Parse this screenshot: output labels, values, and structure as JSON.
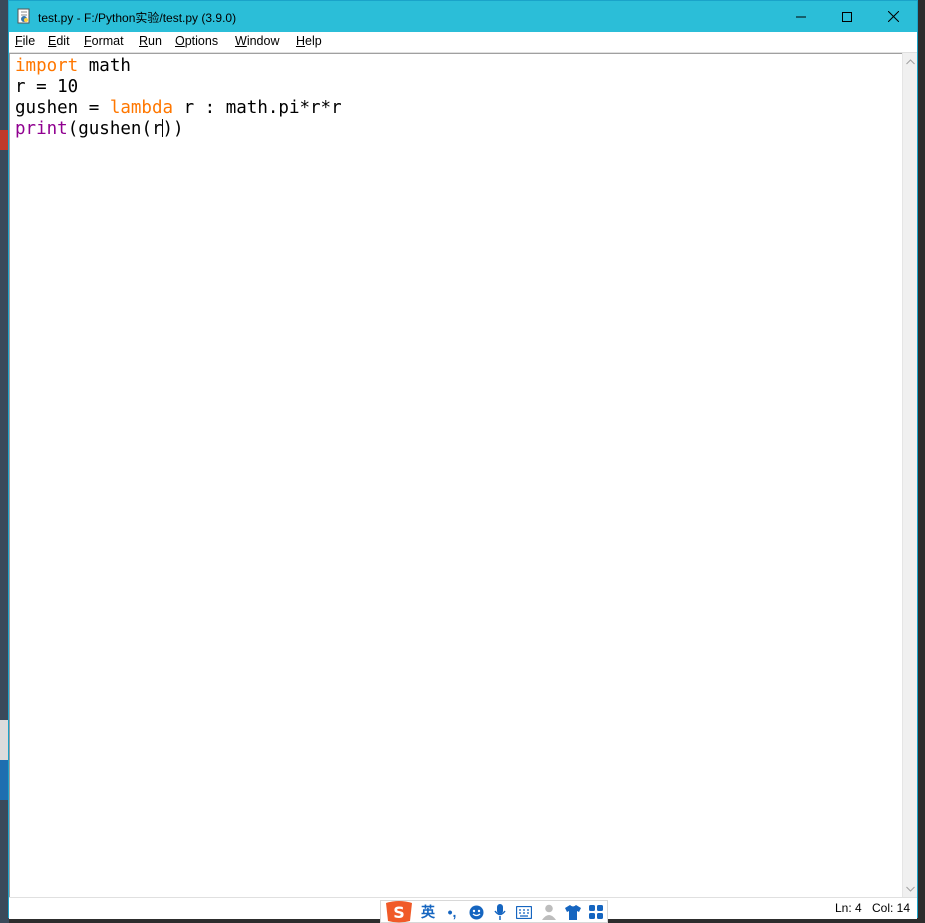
{
  "window": {
    "title": "test.py - F:/Python实验/test.py (3.9.0)",
    "controls": {
      "minimize": "minimize",
      "maximize": "maximize",
      "close": "close"
    }
  },
  "menubar": {
    "items": [
      {
        "label": "File",
        "mnemonic": "F",
        "rest": "ile"
      },
      {
        "label": "Edit",
        "mnemonic": "E",
        "rest": "dit"
      },
      {
        "label": "Format",
        "mnemonic": "F",
        "rest": "ormat"
      },
      {
        "label": "Run",
        "mnemonic": "R",
        "rest": "un"
      },
      {
        "label": "Options",
        "mnemonic": "O",
        "rest": "ptions"
      },
      {
        "label": "Window",
        "mnemonic": "W",
        "rest": "indow"
      },
      {
        "label": "Help",
        "mnemonic": "H",
        "rest": "elp"
      }
    ]
  },
  "editor": {
    "lines": [
      {
        "kw": "import",
        "rest": " math"
      },
      {
        "text": "r = 10"
      },
      {
        "pre": "gushen = ",
        "kw": "lambda",
        "rest": " r : math.pi*r*r"
      },
      {
        "kw": "print",
        "mid": "(gushen(r",
        "after": "))"
      }
    ],
    "colors": {
      "keyword": "#ff7700",
      "builtin": "#900090",
      "text": "#000000"
    }
  },
  "status": {
    "line": "Ln: 4",
    "col": "Col: 14"
  },
  "ime": {
    "logo": "S",
    "lang": "英",
    "punct": "•,",
    "icons": [
      "emoji-icon",
      "microphone-icon",
      "keyboard-icon",
      "user-icon",
      "shirt-icon",
      "grid-icon"
    ]
  },
  "theme": {
    "titlebar": "#2bbed8",
    "window_border": "#1aa3c9"
  }
}
